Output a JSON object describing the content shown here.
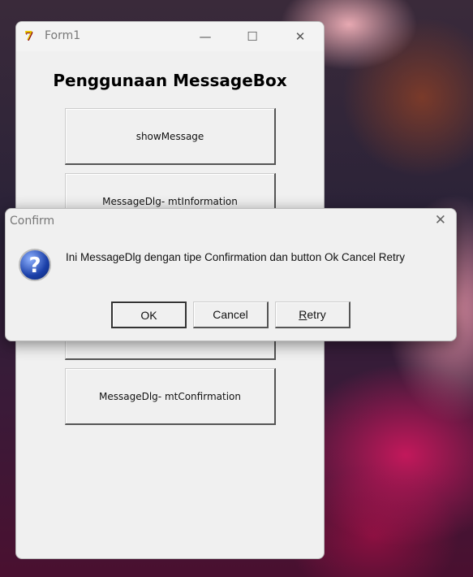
{
  "form": {
    "title": "Form1",
    "icon": "delphi-app-icon",
    "heading": "Penggunaan MessageBox",
    "controls": {
      "minimize": "—",
      "maximize": "☐",
      "close": "✕"
    },
    "buttons": [
      {
        "label": "showMessage"
      },
      {
        "label": "MessageDlg- mtInformation"
      },
      {
        "label": "MessageDlg- mtConfirmation"
      }
    ]
  },
  "dialog": {
    "title": "Confirm",
    "close": "✕",
    "icon": "question-icon",
    "icon_glyph": "?",
    "message": "Ini MessageDlg dengan tipe Confirmation dan button Ok Cancel Retry",
    "buttons": {
      "ok": "OK",
      "cancel": "Cancel",
      "retry_accel": "R",
      "retry_rest": "etry"
    }
  }
}
